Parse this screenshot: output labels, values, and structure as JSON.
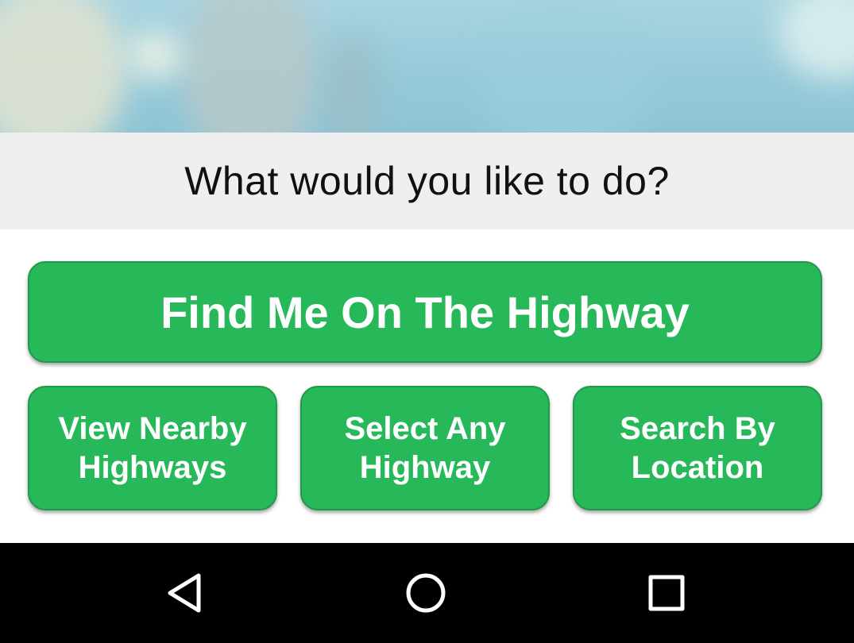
{
  "header": {
    "prompt": "What would you like to do?"
  },
  "actions": {
    "primary_label": "Find Me On The Highway",
    "nearby_label": "View Nearby\nHighways",
    "select_label": "Select Any\nHighway",
    "search_label": "Search By\nLocation"
  },
  "navigation_bar": {
    "back_icon": "triangle-back-icon",
    "home_icon": "circle-home-icon",
    "recents_icon": "square-recents-icon"
  },
  "colors": {
    "button_green": "#27b85a",
    "prompt_bar_bg": "#efefef",
    "nav_bar_bg": "#000000"
  }
}
